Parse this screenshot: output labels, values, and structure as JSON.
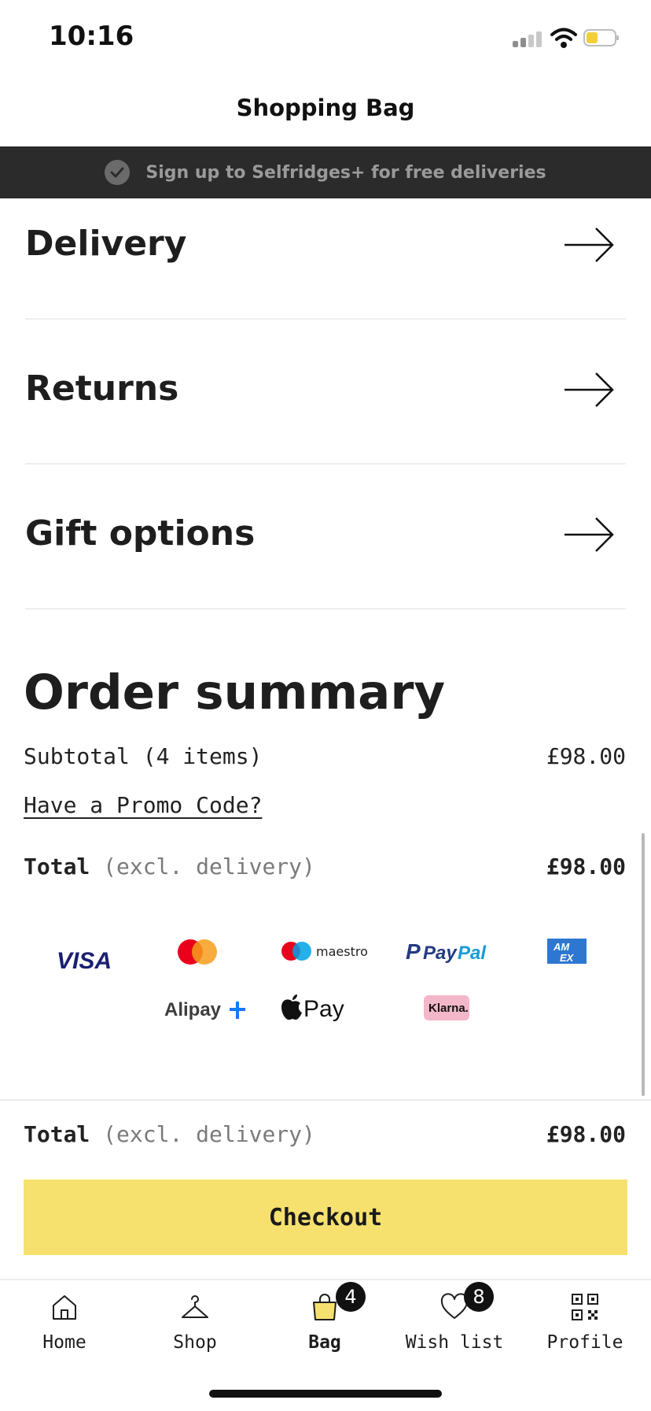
{
  "status_bar": {
    "time": "10:16"
  },
  "header": {
    "title": "Shopping Bag"
  },
  "banner": {
    "text": "Sign up to Selfridges+ for free deliveries"
  },
  "sections": [
    {
      "label": "Delivery"
    },
    {
      "label": "Returns"
    },
    {
      "label": "Gift options"
    }
  ],
  "order_summary": {
    "title": "Order summary",
    "subtotal_label": "Subtotal (4 items)",
    "subtotal_value": "£98.00",
    "promo_link": "Have a Promo Code?",
    "total_label": "Total",
    "total_note": "(excl. delivery)",
    "total_value": "£98.00"
  },
  "payment_methods": {
    "visa": "VISA",
    "mastercard": "mastercard-logo",
    "maestro": "maestro",
    "paypal_pay": "Pay",
    "paypal_pal": "Pal",
    "amex_top": "AM",
    "amex_bottom": "EX",
    "alipay": "Alipay",
    "applepay": "Pay",
    "klarna": "Klarna."
  },
  "footer": {
    "total_label": "Total",
    "total_note": "(excl. delivery)",
    "total_value": "£98.00",
    "checkout_label": "Checkout"
  },
  "tabs": [
    {
      "label": "Home",
      "icon": "home-icon"
    },
    {
      "label": "Shop",
      "icon": "hanger-icon"
    },
    {
      "label": "Bag",
      "icon": "bag-icon",
      "badge": "4",
      "active": true
    },
    {
      "label": "Wish list",
      "icon": "heart-icon",
      "badge": "8"
    },
    {
      "label": "Profile",
      "icon": "qr-code-icon"
    }
  ],
  "colors": {
    "accent": "#f6e16e",
    "banner": "#2b2b2b",
    "amex": "#2e77d0",
    "klarna": "#f4b7c9"
  }
}
